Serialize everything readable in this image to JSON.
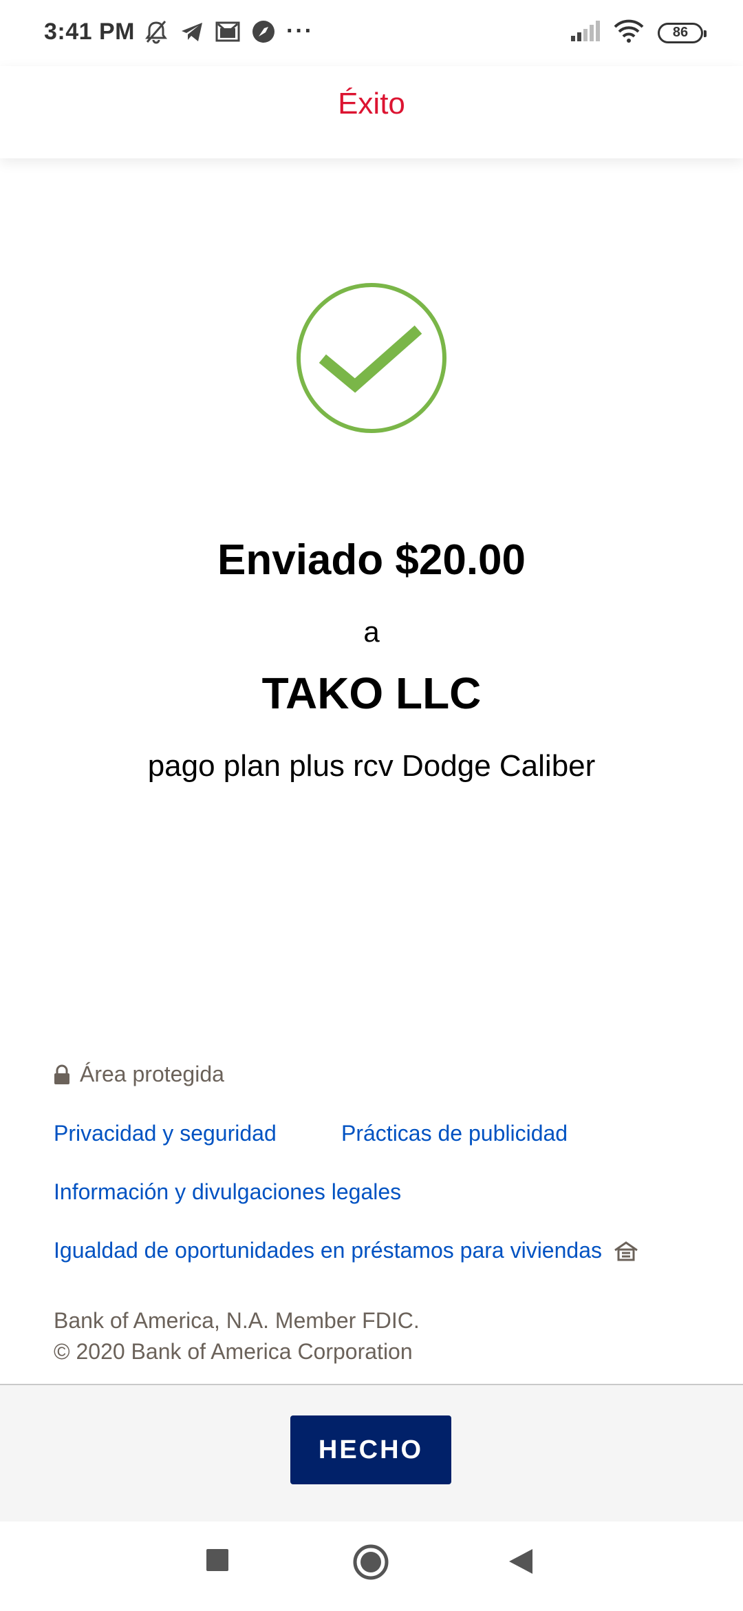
{
  "status_bar": {
    "time": "3:41 PM",
    "overflow": "···",
    "battery": "86",
    "left_icons": [
      "notifications-muted-icon",
      "telegram-icon",
      "gmail-icon",
      "app-notification-icon"
    ],
    "right_icons": [
      "signal-icon",
      "wifi-icon",
      "battery-icon"
    ]
  },
  "header": {
    "title": "Éxito"
  },
  "confirmation": {
    "icon": "checkmark-circle-icon",
    "sent_line": "Enviado $20.00",
    "connector": "a",
    "recipient": "TAKO LLC",
    "memo": "pago plan plus rcv Dodge Caliber"
  },
  "footer": {
    "secure_label": "Área protegida",
    "links": {
      "privacy": "Privacidad y seguridad",
      "advertising": "Prácticas de publicidad",
      "legal": "Información y divulgaciones legales",
      "housing": "Igualdad de oportunidades en préstamos para viviendas"
    },
    "legal_line1": "Bank of America, N.A. Member FDIC.",
    "legal_line2": "© 2020 Bank of America Corporation"
  },
  "actions": {
    "done_label": "HECHO"
  },
  "nav_bar": {
    "buttons": [
      "recent-apps",
      "home",
      "back"
    ]
  },
  "colors": {
    "accent_red": "#dc1431",
    "success_green": "#7ab648",
    "link_blue": "#0052c2",
    "button_navy": "#012169",
    "muted_text": "#6b625a"
  }
}
